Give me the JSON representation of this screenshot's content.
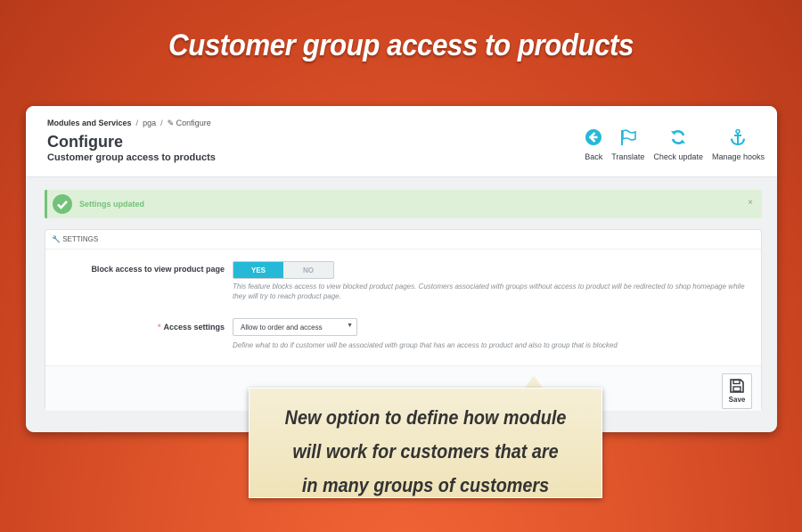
{
  "headline": "Customer group access to products",
  "breadcrumb": {
    "root": "Modules and Services",
    "module": "pga",
    "current": "Configure"
  },
  "page": {
    "title": "Configure",
    "subtitle": "Customer group access to products"
  },
  "toolbar": {
    "back": "Back",
    "translate": "Translate",
    "check_update": "Check update",
    "manage_hooks": "Manage hooks"
  },
  "alert": {
    "message": "Settings updated",
    "close": "×"
  },
  "panel": {
    "heading": "SETTINGS",
    "block_access": {
      "label": "Block access to view product page",
      "yes": "YES",
      "no": "NO",
      "help": "This feature blocks access to view blocked product pages. Customers associated with groups without access to product will be redirected to shop homepage while they will try to reach product page."
    },
    "access_settings": {
      "required_mark": "*",
      "label": "Access settings",
      "value": "Allow to order and access",
      "help": "Define what to do if customer will be associated with group that has an access to product and also to group that is blocked"
    },
    "save": "Save"
  },
  "callout": {
    "lines": [
      "New option to define how module",
      "will work for customers that are",
      "in many groups of customers"
    ]
  },
  "colors": {
    "accent": "#25b9d7",
    "success": "#72c279",
    "background": "#d9502a"
  }
}
